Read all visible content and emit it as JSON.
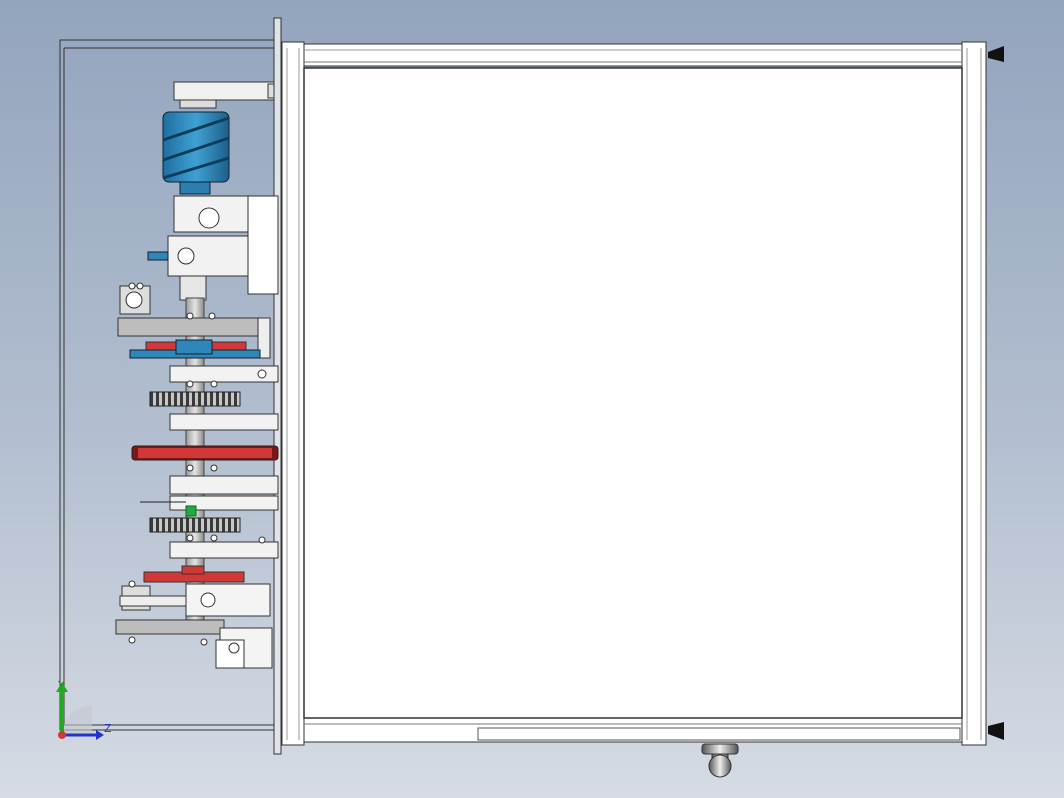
{
  "view": {
    "background_top": "#93a4bd",
    "background_bottom": "#d6dbe4",
    "part_blue": "#2f86b8",
    "part_red": "#d23838",
    "frame_white": "#ffffff"
  },
  "triad": {
    "y_axis_label": "Y",
    "z_axis_label": "Z",
    "y_color": "#22aa22",
    "z_color": "#2233cc"
  }
}
